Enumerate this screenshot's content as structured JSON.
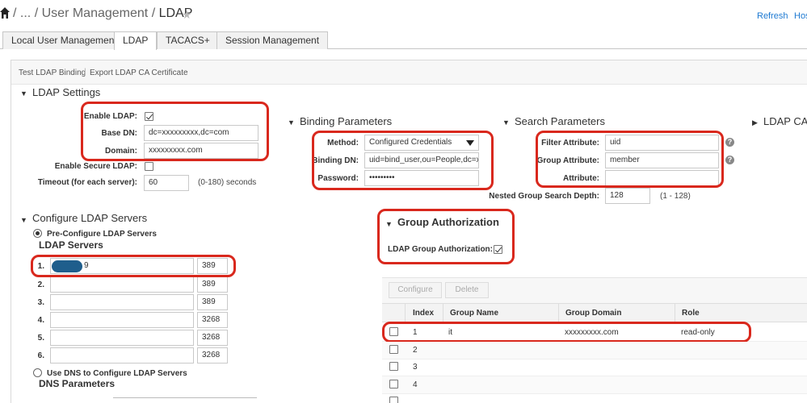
{
  "header": {
    "breadcrumb_sep": "/",
    "breadcrumb_ellipsis": "...",
    "breadcrumb_parent": "User Management",
    "breadcrumb_current": "LDAP",
    "refresh_label": "Refresh",
    "host_label": "Hos"
  },
  "tabs": [
    "Local User Management",
    "LDAP",
    "TACACS+",
    "Session Management"
  ],
  "toolbar": {
    "test_binding": "Test LDAP Binding",
    "separator": "|",
    "export_cert": "Export LDAP CA Certificate"
  },
  "ldap_settings": {
    "title": "LDAP Settings",
    "enable_ldap_label": "Enable LDAP:",
    "enable_ldap_checked": true,
    "base_dn_label": "Base DN:",
    "base_dn_value": "dc=xxxxxxxxx,dc=com",
    "domain_label": "Domain:",
    "domain_value": "xxxxxxxxx.com",
    "enable_secure_label": "Enable Secure LDAP:",
    "enable_secure_checked": false,
    "timeout_label": "Timeout (for each server):",
    "timeout_value": "60",
    "timeout_hint": "(0-180) seconds"
  },
  "binding": {
    "title": "Binding Parameters",
    "method_label": "Method:",
    "method_value": "Configured Credentials",
    "binding_dn_label": "Binding DN:",
    "binding_dn_value": "uid=bind_user,ou=People,dc=xx",
    "password_label": "Password:",
    "password_value": "•••••••••"
  },
  "search": {
    "title": "Search Parameters",
    "filter_label": "Filter Attribute:",
    "filter_value": "uid",
    "group_label": "Group Attribute:",
    "group_value": "member",
    "attribute_label": "Attribute:",
    "attribute_value": "",
    "nested_label": "Nested Group Search Depth:",
    "nested_value": "128",
    "nested_hint": "(1 - 128)"
  },
  "ldap_ca": {
    "title": "LDAP CA C"
  },
  "servers": {
    "title": "Configure LDAP Servers",
    "preconfig_label": "Pre-Configure LDAP Servers",
    "preconfig_selected": true,
    "list_title": "LDAP Servers",
    "rows": [
      {
        "index": "1.",
        "address": "9",
        "port": "389"
      },
      {
        "index": "2.",
        "address": "",
        "port": "389"
      },
      {
        "index": "3.",
        "address": "",
        "port": "389"
      },
      {
        "index": "4.",
        "address": "",
        "port": "3268"
      },
      {
        "index": "5.",
        "address": "",
        "port": "3268"
      },
      {
        "index": "6.",
        "address": "",
        "port": "3268"
      }
    ],
    "dns_label": "Use DNS to Configure LDAP Servers",
    "dns_selected": false,
    "dns_title": "DNS Parameters"
  },
  "group_auth": {
    "title": "Group Authorization",
    "label": "LDAP Group Authorization:",
    "checked": true,
    "configure_button": "Configure",
    "delete_button": "Delete",
    "columns": [
      "Index",
      "Group Name",
      "Group Domain",
      "Role"
    ],
    "rows": [
      {
        "index": "1",
        "name": "it",
        "domain": "xxxxxxxxx.com",
        "role": "read-only"
      },
      {
        "index": "2",
        "name": "",
        "domain": "",
        "role": ""
      },
      {
        "index": "3",
        "name": "",
        "domain": "",
        "role": ""
      },
      {
        "index": "4",
        "name": "",
        "domain": "",
        "role": ""
      }
    ]
  },
  "colors": {
    "highlight": "#d9281d",
    "link": "#1e7ad2",
    "redacted": "#1f5e8c"
  }
}
